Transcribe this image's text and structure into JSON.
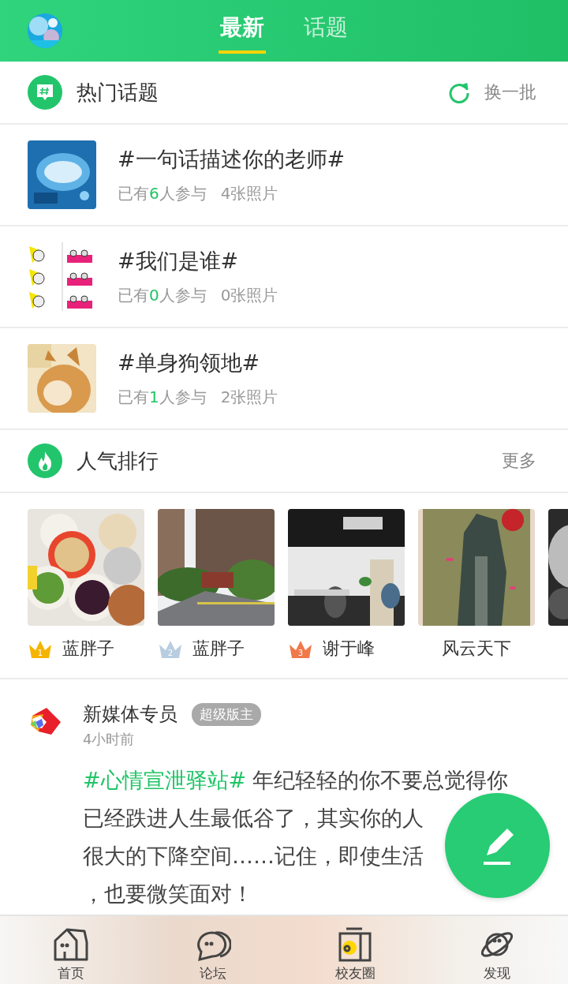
{
  "header": {
    "tabs": [
      {
        "label": "最新",
        "selected": true
      },
      {
        "label": "话题",
        "selected": false
      }
    ]
  },
  "hot_topics": {
    "title": "热门话题",
    "action": "换一批",
    "items": [
      {
        "title": "#一句话描述你的老师#",
        "participants_before": "已有",
        "participants_count": "6",
        "participants_after": "人参与",
        "photos": "4张照片"
      },
      {
        "title": "#我们是谁#",
        "participants_before": "已有",
        "participants_count": "0",
        "participants_after": "人参与",
        "photos": "0张照片"
      },
      {
        "title": "#单身狗领地#",
        "participants_before": "已有",
        "participants_count": "1",
        "participants_after": "人参与",
        "photos": "2张照片"
      }
    ]
  },
  "ranking": {
    "title": "人气排行",
    "more": "更多",
    "items": [
      {
        "name": "蓝胖子",
        "rank": "1",
        "color": "#f5b400"
      },
      {
        "name": "蓝胖子",
        "rank": "2",
        "color": "#b9cde0"
      },
      {
        "name": "谢于峰",
        "rank": "3",
        "color": "#f0784a"
      },
      {
        "name": "风云天下"
      }
    ]
  },
  "post": {
    "author": "新媒体专员",
    "badge": "超级版主",
    "time": "4小时前",
    "tag": "#心情宣泄驿站#",
    "lines": [
      "年纪轻轻的你不要总觉得你",
      "已经跌进人生最低谷了，其实你的人",
      "很大的下降空间……记住，即使生活",
      "，也要微笑面对！"
    ]
  },
  "bottom_nav": [
    {
      "label": "首页"
    },
    {
      "label": "论坛"
    },
    {
      "label": "校友圈"
    },
    {
      "label": "发现"
    }
  ]
}
